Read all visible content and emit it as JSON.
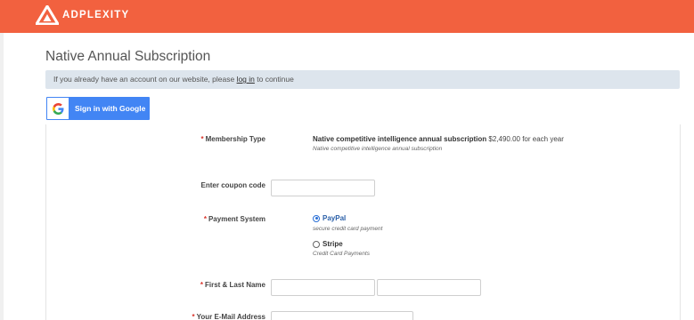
{
  "brand": {
    "name": "ADPLEXITY",
    "accent": "#f2613f",
    "logo_icon": "adplexity-logo-icon"
  },
  "page": {
    "title": "Native Annual Subscription"
  },
  "login_notice": {
    "before": "If you already have an account on our website, please ",
    "link": "log in",
    "after": " to continue"
  },
  "google": {
    "label": "Sign in with Google",
    "icon": "google-icon",
    "color": "#4285f4"
  },
  "form": {
    "membership": {
      "label": "Membership Type",
      "plan_name": "Native competitive intelligence annual subscription",
      "price": "$2,490.00 for each year",
      "note": "Native competitive intelligence annual subscription"
    },
    "coupon": {
      "label": "Enter coupon code",
      "value": "",
      "placeholder": ""
    },
    "payment": {
      "label": "Payment System",
      "options": [
        {
          "name": "PayPal",
          "note": "secure credit card payment",
          "selected": true
        },
        {
          "name": "Stripe",
          "note": "Credit Card Payments",
          "selected": false
        }
      ]
    },
    "name": {
      "label": "First & Last Name",
      "first_value": "",
      "last_value": ""
    },
    "email": {
      "label": "Your E-Mail Address",
      "value": ""
    },
    "required_marker": "*"
  }
}
